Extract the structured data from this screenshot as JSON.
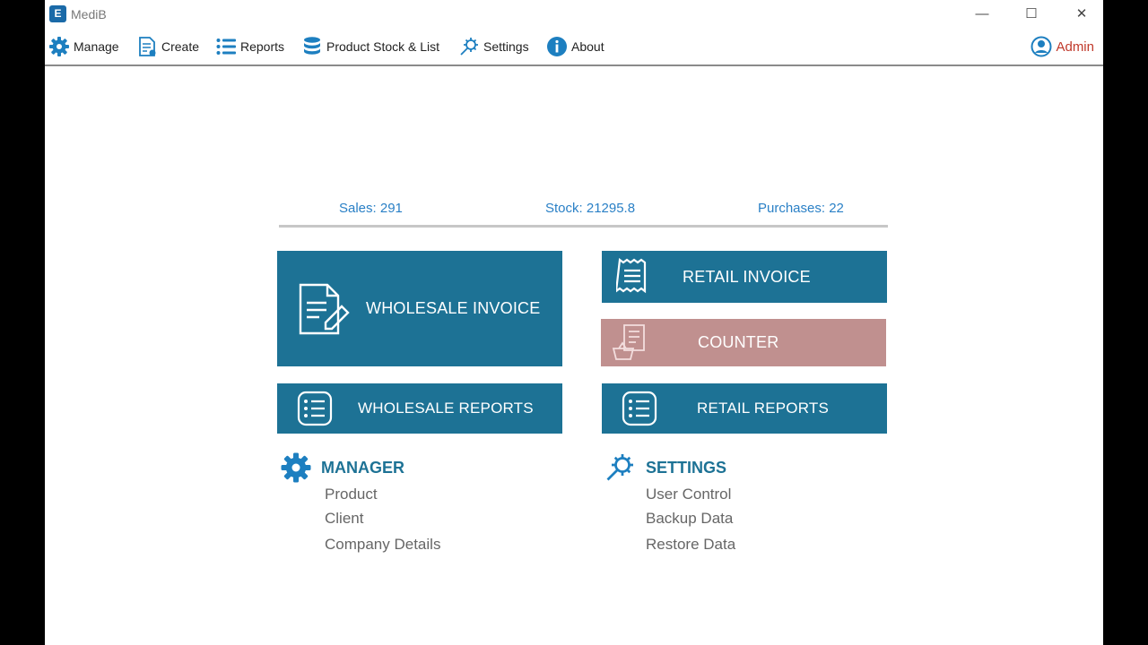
{
  "window": {
    "title": "MediB",
    "app_icon_letter": "E",
    "controls": {
      "minimize": "—",
      "maximize": "☐",
      "close": "✕"
    }
  },
  "menu": {
    "items": [
      {
        "label": "Manage",
        "icon": "gear-icon"
      },
      {
        "label": "Create",
        "icon": "document-icon"
      },
      {
        "label": "Reports",
        "icon": "list-icon"
      },
      {
        "label": "Product Stock & List",
        "icon": "database-icon"
      },
      {
        "label": "Settings",
        "icon": "wrench-gear-icon"
      },
      {
        "label": "About",
        "icon": "info-icon"
      }
    ],
    "user": "Admin"
  },
  "stats": {
    "sales": "Sales: 291",
    "stock": "Stock: 21295.8",
    "purchases": "Purchases: 22"
  },
  "tiles": {
    "wholesale_invoice": "WHOLESALE INVOICE",
    "retail_invoice": "RETAIL INVOICE",
    "counter": "COUNTER",
    "wholesale_reports": "WHOLESALE REPORTS",
    "retail_reports": "RETAIL REPORTS"
  },
  "manager": {
    "title": "MANAGER",
    "links": [
      "Product",
      "Client",
      "Company Details"
    ]
  },
  "settings": {
    "title": "SETTINGS",
    "links": [
      "User Control",
      "Backup Data",
      "Restore Data"
    ]
  },
  "colors": {
    "tile": "#1d7295",
    "counter": "#c0908f",
    "stat_text": "#2a80c6",
    "admin": "#c0392b"
  }
}
